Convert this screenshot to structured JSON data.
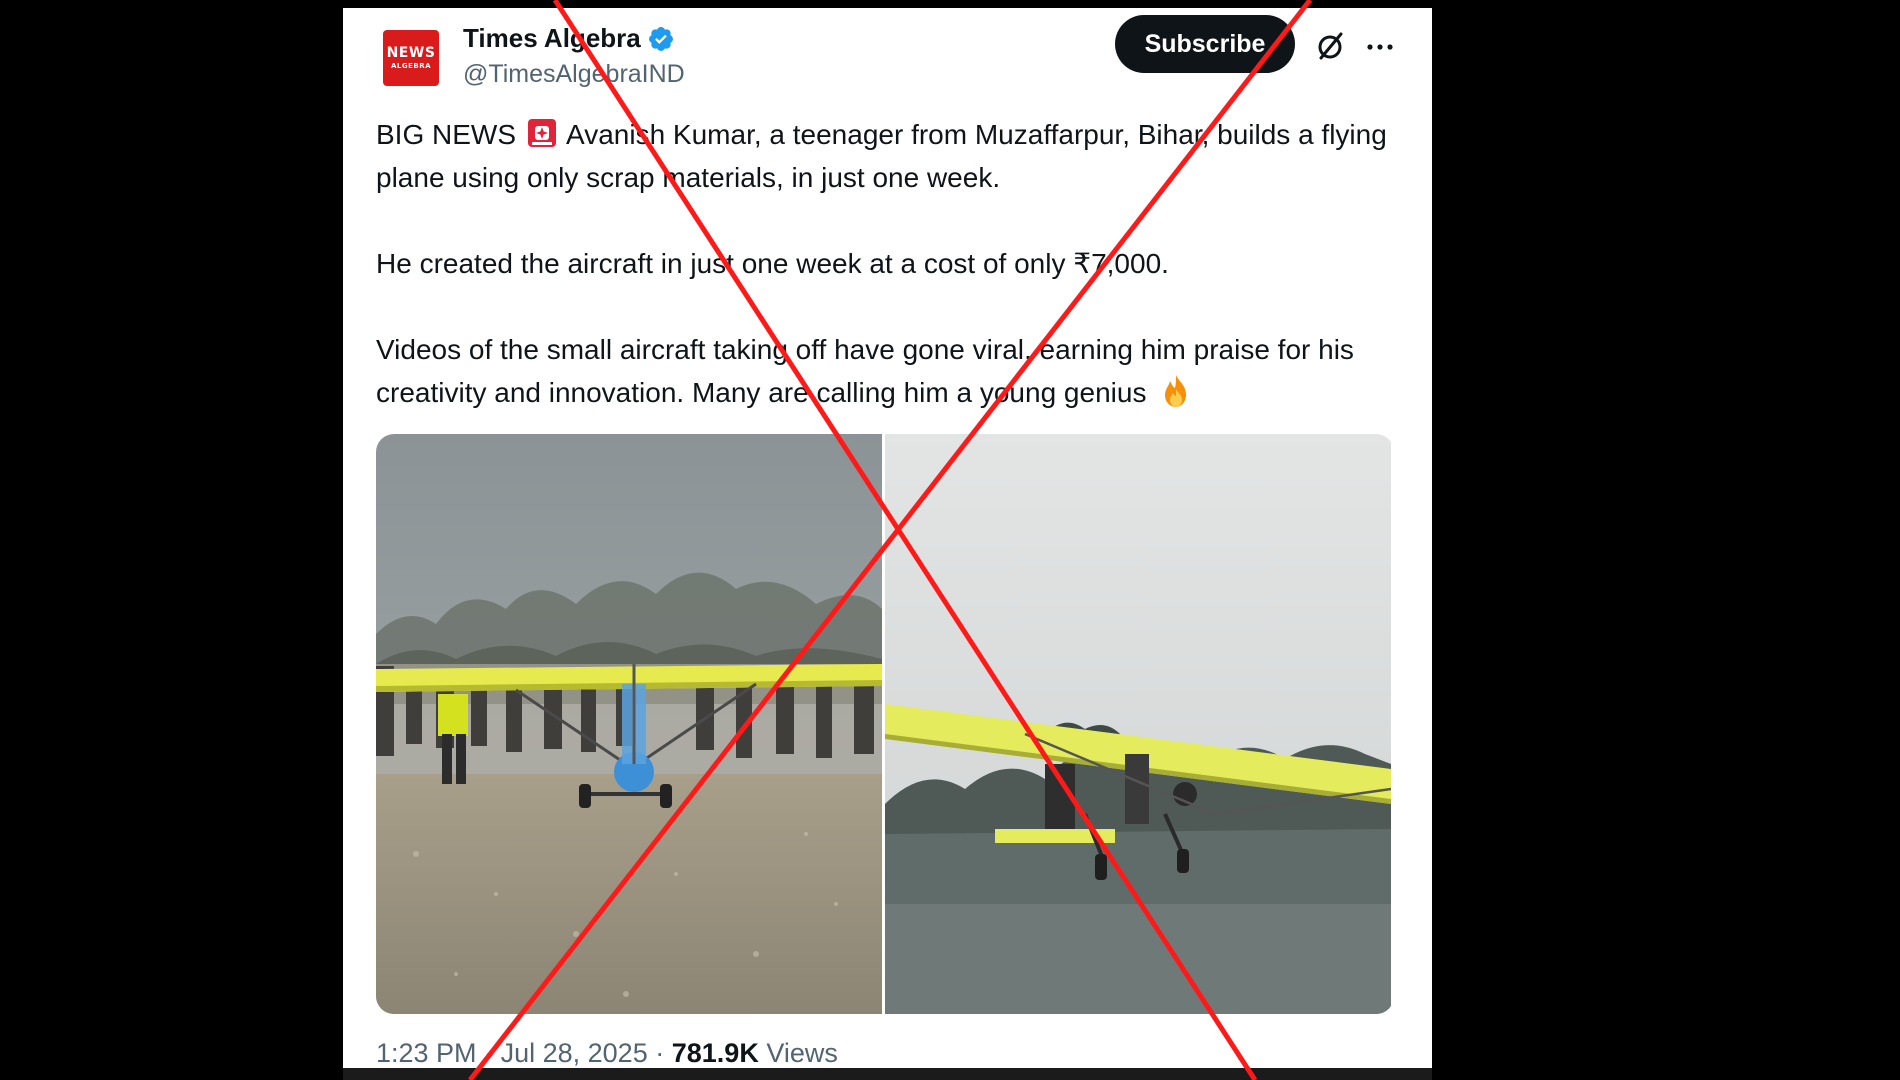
{
  "account": {
    "display_name": "Times Algebra",
    "handle": "@TimesAlgebraIND",
    "avatar_line1": "NEWS",
    "avatar_line2": "ALGEBRA",
    "verified": true
  },
  "header_actions": {
    "subscribe_label": "Subscribe",
    "grok_icon": "grok-icon",
    "more_icon": "more-icon"
  },
  "tweet": {
    "line1_prefix": "BIG NEWS",
    "line1_rest": "Avanish Kumar, a teenager from Muzaffarpur, Bihar, builds a flying plane using only scrap materials, in just one week.",
    "paragraph2": "He created the aircraft in just one week at a cost of only ₹7,000.",
    "paragraph3": "Videos of the small aircraft taking off have gone viral, earning him praise for his creativity and innovation. Many are calling him a young genius",
    "emoji_1": "police-siren-emoji",
    "emoji_2": "fire-emoji"
  },
  "media": [
    {
      "name": "photo-plane-on-ground-crowd"
    },
    {
      "name": "photo-plane-in-flight"
    }
  ],
  "meta": {
    "time": "1:23 PM",
    "separator": "·",
    "date": "Jul 28, 2025",
    "views_count": "781.9K",
    "views_label": "Views"
  },
  "overlay": {
    "mark": "red-x-cross",
    "color": "#ff1a1a"
  },
  "colors": {
    "text_primary": "#0f1419",
    "text_secondary": "#536471",
    "verified_blue": "#1d9bf0",
    "subscribe_bg": "#0f1419"
  }
}
